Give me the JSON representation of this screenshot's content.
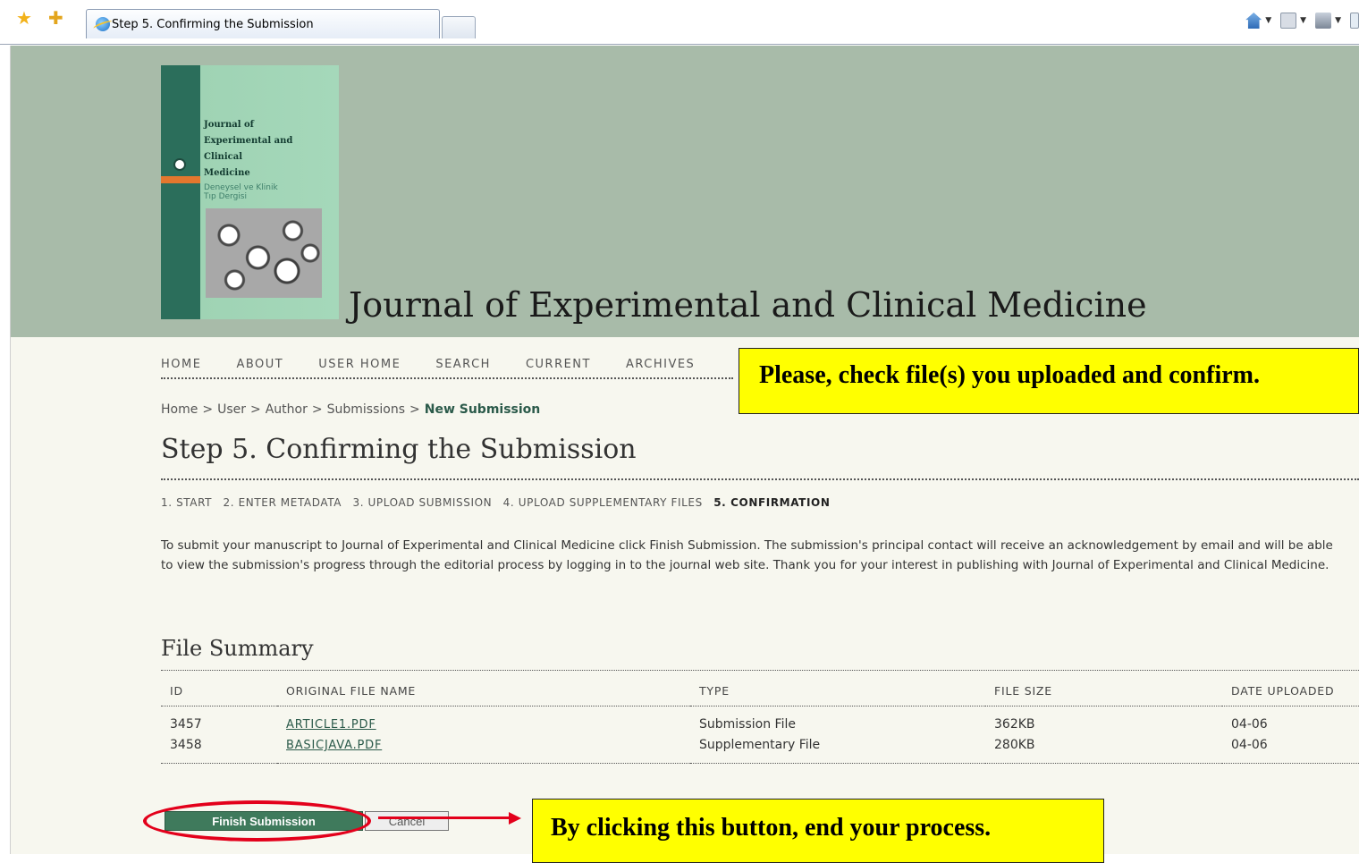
{
  "browser": {
    "tab_title": "Step 5. Confirming the Submission"
  },
  "header": {
    "journal_title": "Journal of Experimental and Clinical Medicine",
    "cover": {
      "title": "Journal of\nExperimental and\nClinical\nMedicine",
      "subtitle": "Deneysel ve Klinik\nTıp Dergisi"
    }
  },
  "nav": {
    "items": [
      "HOME",
      "ABOUT",
      "USER HOME",
      "SEARCH",
      "CURRENT",
      "ARCHIVES"
    ]
  },
  "breadcrumb": {
    "items": [
      "Home",
      "User",
      "Author",
      "Submissions"
    ],
    "separator": ">",
    "current": "New Submission"
  },
  "page": {
    "heading": "Step 5. Confirming the Submission",
    "steps": [
      "1. START",
      "2. ENTER METADATA",
      "3. UPLOAD SUBMISSION",
      "4. UPLOAD SUPPLEMENTARY FILES"
    ],
    "current_step": "5. CONFIRMATION",
    "intro": "To submit your manuscript to Journal of Experimental and Clinical Medicine click Finish Submission. The submission's principal contact will receive an acknowledgement by email and will be able to view the submission's progress through the editorial process by logging in to the journal web site. Thank you for your interest in publishing with Journal of Experimental and Clinical Medicine."
  },
  "file_summary": {
    "heading": "File Summary",
    "columns": [
      "ID",
      "ORIGINAL FILE NAME",
      "TYPE",
      "FILE SIZE",
      "DATE UPLOADED"
    ],
    "rows": [
      {
        "id": "3457",
        "name": "ARTICLE1.PDF",
        "type": "Submission File",
        "size": "362KB",
        "date": "04-06"
      },
      {
        "id": "3458",
        "name": "BASICJAVA.PDF",
        "type": "Supplementary File",
        "size": "280KB",
        "date": "04-06"
      }
    ]
  },
  "actions": {
    "finish_label": "Finish Submission",
    "cancel_label": "Cancel"
  },
  "callouts": {
    "top": "Please, check file(s) you uploaded and confirm.",
    "bottom": "By clicking this button, end your process."
  },
  "colors": {
    "header_bg": "#a8bba9",
    "page_bg": "#f7f7ef",
    "link_green": "#2b5a4a",
    "button_green": "#3f7a5c",
    "callout_yellow": "#ffff00",
    "highlight_red": "#e3001b"
  },
  "icons": [
    "favorites-star-icon",
    "add-favorites-icon",
    "ie-page-icon",
    "home-icon",
    "feeds-icon",
    "print-icon",
    "page-menu-icon"
  ]
}
